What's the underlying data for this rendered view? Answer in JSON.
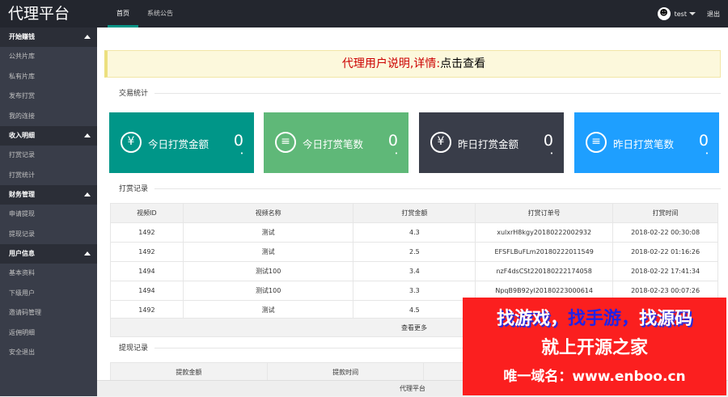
{
  "header": {
    "logo": "代理平台",
    "nav": [
      "首页",
      "系统公告"
    ],
    "active_nav": 0,
    "user": "test",
    "logout": "退出",
    "avatar_icon": "ghost-avatar-icon"
  },
  "sidebar": {
    "groups": [
      {
        "title": "开始赚钱",
        "items": [
          "公共片库",
          "私有片库",
          "发布打赏",
          "我的连接"
        ]
      },
      {
        "title": "收入明细",
        "items": [
          "打赏记录",
          "打赏统计"
        ]
      },
      {
        "title": "财务管理",
        "items": [
          "申请提现",
          "提现记录"
        ]
      },
      {
        "title": "用户信息",
        "items": [
          "基本资料",
          "下级用户",
          "邀请码管理",
          "返佣明细"
        ]
      }
    ],
    "safe_exit": "安全退出"
  },
  "notice": {
    "text": "代理用户说明,详情:",
    "link": "点击查看"
  },
  "stats": {
    "legend": "交易统计",
    "cards": [
      {
        "label": "今日打赏金额",
        "value": "0",
        "icon": "yen-circle-icon",
        "color": "#009688"
      },
      {
        "label": "今日打赏笔数",
        "value": "0",
        "icon": "list-circle-icon",
        "color": "#5fb878"
      },
      {
        "label": "昨日打赏金额",
        "value": "0",
        "icon": "yen-circle-icon",
        "color": "#393d49"
      },
      {
        "label": "昨日打赏笔数",
        "value": "0",
        "icon": "list-circle-icon",
        "color": "#1e9fff"
      }
    ]
  },
  "records": {
    "legend": "打赏记录",
    "columns": [
      "视频ID",
      "视频名称",
      "打赏金额",
      "打赏订单号",
      "打赏时间"
    ],
    "rows": [
      [
        "1492",
        "测试",
        "4.3",
        "xulxrH8kgy20180222002932",
        "2018-02-22 00:30:08"
      ],
      [
        "1492",
        "测试",
        "2.5",
        "EFSFLBuFLm20180222011549",
        "2018-02-22 01:16:26"
      ],
      [
        "1494",
        "测试100",
        "3.4",
        "nzF4dsCSt220180222174058",
        "2018-02-22 17:41:34"
      ],
      [
        "1494",
        "测试100",
        "3.3",
        "NpqB9B92yl20180223000614",
        "2018-02-23 00:07:26"
      ],
      [
        "1492",
        "测试",
        "4.5",
        "",
        ""
      ]
    ],
    "more": "查看更多"
  },
  "withdraw": {
    "legend": "提现记录",
    "columns": [
      "提款金额",
      "提款时间"
    ]
  },
  "footer": "代理平台",
  "ad": {
    "line1a": "找游戏，",
    "line1b": "找手游，",
    "line1c": "找源码",
    "line2": "就上开源之家",
    "line3": "唯一域名：www.enboo.cn"
  }
}
